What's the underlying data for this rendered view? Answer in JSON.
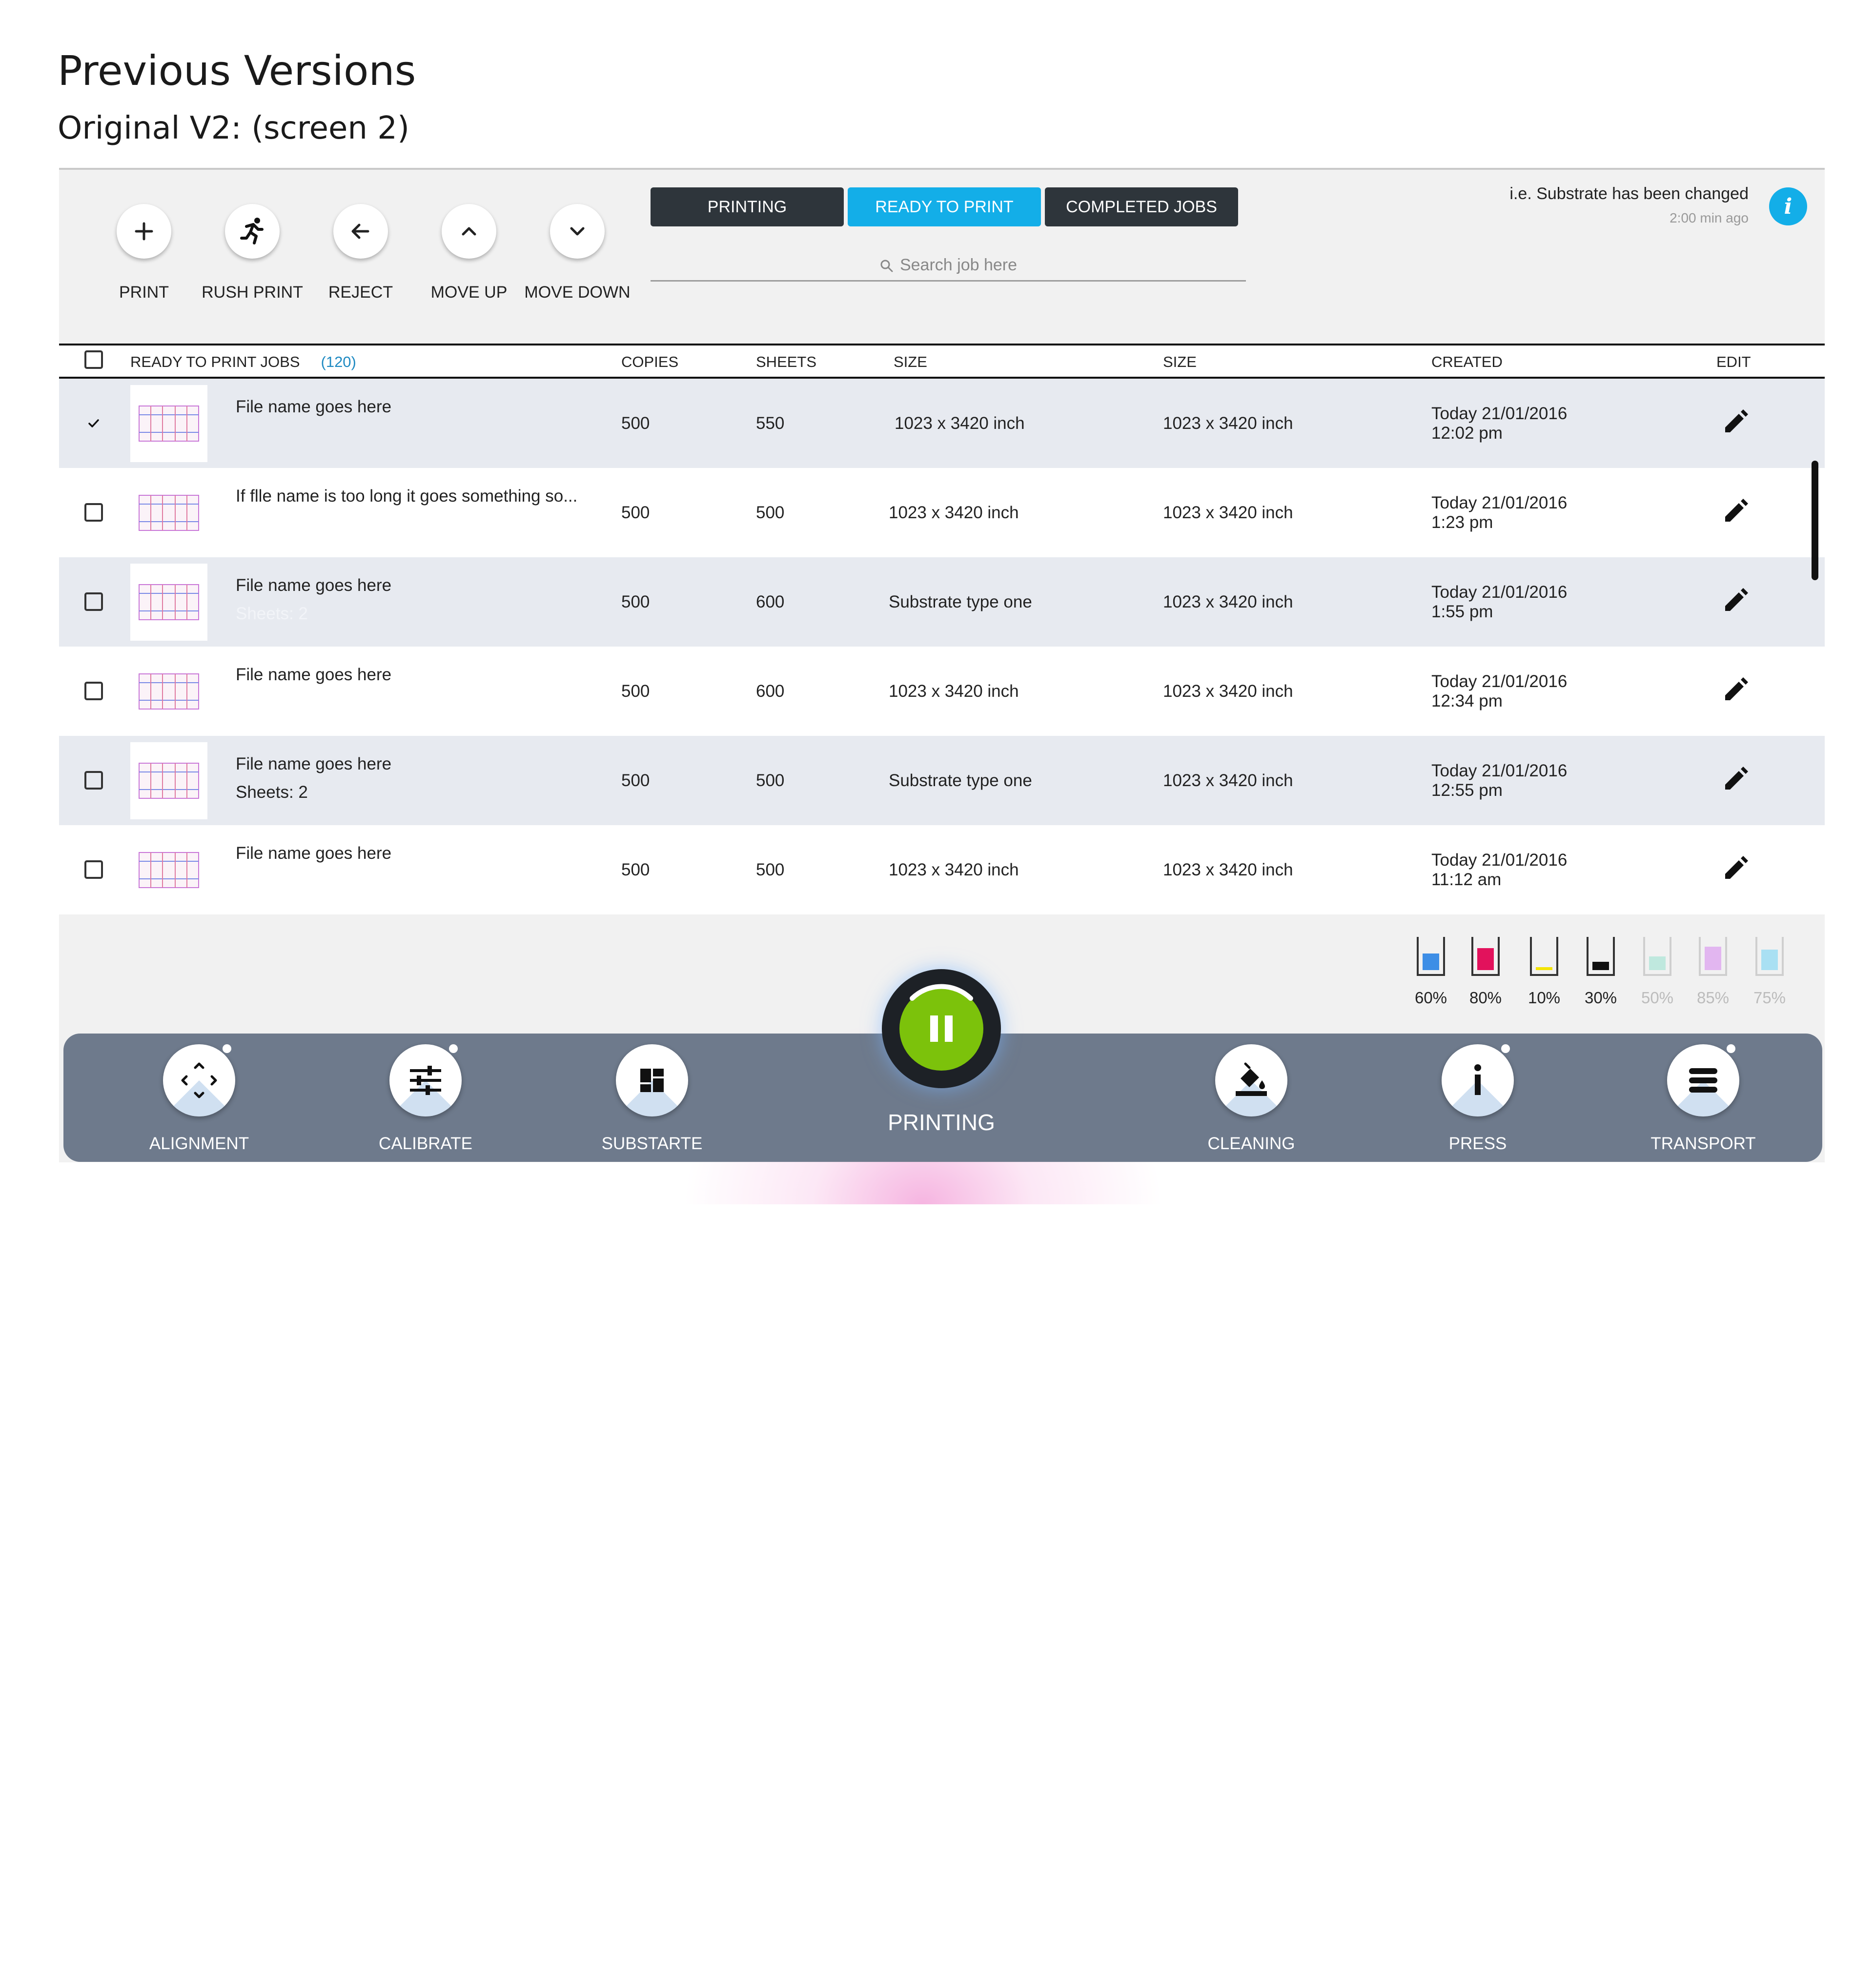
{
  "page": {
    "title": "Previous Versions",
    "subtitle": "Original V2: (screen 2)"
  },
  "toolbar": {
    "actions": [
      {
        "label": "PRINT",
        "icon": "plus-icon"
      },
      {
        "label": "RUSH PRINT",
        "icon": "running-person-icon"
      },
      {
        "label": "REJECT",
        "icon": "arrow-left-icon"
      },
      {
        "label": "MOVE UP",
        "icon": "chevron-up-icon"
      },
      {
        "label": "MOVE DOWN",
        "icon": "chevron-down-icon"
      }
    ]
  },
  "tabs": [
    {
      "label": "PRINTING",
      "active": false
    },
    {
      "label": "READY TO PRINT",
      "active": true
    },
    {
      "label": "COMPLETED JOBS",
      "active": false
    }
  ],
  "search": {
    "placeholder": "Search job here"
  },
  "notification": {
    "message": "i.e. Substrate has been changed",
    "time": "2:00 min ago",
    "icon": "info-icon"
  },
  "table": {
    "headers": {
      "jobs": "READY TO PRINT JOBS",
      "count": "(120)",
      "copies": "COPIES",
      "sheets": "SHEETS",
      "size1": "SIZE",
      "size2": "SIZE",
      "created": "CREATED",
      "edit": "EDIT"
    },
    "rows": [
      {
        "checked": true,
        "name": "File name goes here",
        "sub": "",
        "copies": "500",
        "sheets": "550",
        "size1": "1023 x 3420 inch",
        "size2": "1023 x 3420 inch",
        "date": "Today 21/01/2016",
        "time": "12:02 pm"
      },
      {
        "checked": false,
        "name": "If flle name is too long it goes something so...",
        "sub": "",
        "copies": "500",
        "sheets": "500",
        "size1": "1023 x 3420 inch",
        "size2": "1023 x 3420 inch",
        "date": "Today 21/01/2016",
        "time": "1:23 pm"
      },
      {
        "checked": false,
        "name": "File name goes here",
        "sub": "Sheets: 2",
        "copies": "500",
        "sheets": "600",
        "size1": "Substrate type one",
        "size2": "1023 x 3420 inch",
        "date": "Today 21/01/2016",
        "time": "1:55 pm"
      },
      {
        "checked": false,
        "name": "File name goes here",
        "sub": "",
        "copies": "500",
        "sheets": "600",
        "size1": "1023 x 3420 inch",
        "size2": "1023 x 3420 inch",
        "date": "Today 21/01/2016",
        "time": "12:34 pm"
      },
      {
        "checked": false,
        "name": "File name goes here",
        "sub": "Sheets: 2",
        "copies": "500",
        "sheets": "500",
        "size1": "Substrate type one",
        "size2": "1023 x 3420 inch",
        "date": "Today 21/01/2016",
        "time": "12:55 pm"
      },
      {
        "checked": false,
        "name": "File name goes here",
        "sub": "",
        "copies": "500",
        "sheets": "500",
        "size1": "1023 x 3420 inch",
        "size2": "1023 x 3420 inch",
        "date": "Today 21/01/2016",
        "time": "11:12 am"
      }
    ]
  },
  "ink_levels": [
    {
      "label": "60%",
      "level": 0.6,
      "color": "#3d8ee6",
      "faded": false
    },
    {
      "label": "80%",
      "level": 0.8,
      "color": "#e2125c",
      "faded": false
    },
    {
      "label": "10%",
      "level": 0.1,
      "color": "#f4e400",
      "faded": false
    },
    {
      "label": "30%",
      "level": 0.3,
      "color": "#111111",
      "faded": false
    },
    {
      "label": "50%",
      "level": 0.5,
      "color": "#bfe8de",
      "faded": true
    },
    {
      "label": "85%",
      "level": 0.85,
      "color": "#e2b6f0",
      "faded": true
    },
    {
      "label": "75%",
      "level": 0.75,
      "color": "#a9e0f3",
      "faded": true
    }
  ],
  "bottom_nav": {
    "left": [
      {
        "label": "ALIGNMENT",
        "icon": "alignment-arrows-icon"
      },
      {
        "label": "CALIBRATE",
        "icon": "sliders-icon"
      },
      {
        "label": "SUBSTARTE",
        "icon": "dashboard-grid-icon"
      }
    ],
    "center": {
      "label": "PRINTING",
      "icon": "pause-icon"
    },
    "right": [
      {
        "label": "CLEANING",
        "icon": "paint-bucket-icon"
      },
      {
        "label": "PRESS",
        "icon": "info-i-icon"
      },
      {
        "label": "TRANSPORT",
        "icon": "transport-stack-icon"
      }
    ]
  }
}
